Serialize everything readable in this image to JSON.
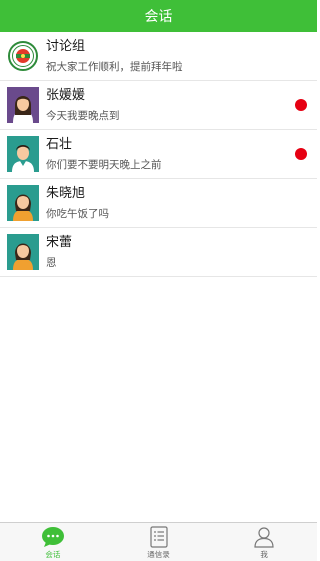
{
  "header": {
    "title": "会话"
  },
  "conversations": [
    {
      "name": "讨论组",
      "message": "祝大家工作顺利，提前拜年啦",
      "avatar": "group-logo-icon",
      "unread": false
    },
    {
      "name": "张媛媛",
      "message": "今天我要晚点到",
      "avatar": "woman-purple-avatar",
      "unread": true
    },
    {
      "name": "石壮",
      "message": "你们要不要明天晚上之前",
      "avatar": "man-teal-avatar",
      "unread": true
    },
    {
      "name": "朱晓旭",
      "message": "你吃午饭了吗",
      "avatar": "woman-teal-avatar",
      "unread": false
    },
    {
      "name": "宋蕾",
      "message": "恩",
      "avatar": "woman-teal-avatar-2",
      "unread": false
    }
  ],
  "tabbar": {
    "tabs": [
      {
        "label": "会话",
        "icon": "chat-bubble-icon",
        "active": true
      },
      {
        "label": "通信录",
        "icon": "contacts-list-icon",
        "active": false
      },
      {
        "label": "我",
        "icon": "person-icon",
        "active": false
      }
    ]
  },
  "colors": {
    "accent": "#3fbf38",
    "unread_dot": "#e60012"
  }
}
